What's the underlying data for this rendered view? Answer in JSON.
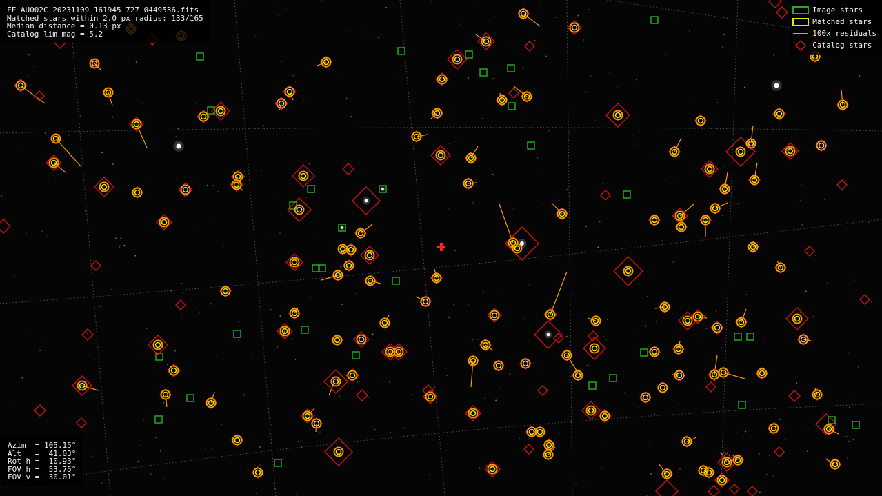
{
  "overlay": {
    "filename": "FF_AU002C_20231109_161945_727_0449536.fits",
    "matched": "Matched stars within 2.0 px radius: 133/165",
    "median": "Median distance = 0.13 px",
    "limmag": "Catalog lim mag = 5.2"
  },
  "pointing": {
    "azim": "Azim  = 105.15°",
    "alt": "Alt   =  41.03°",
    "roth": "Rot h =  10.93°",
    "fovh": "FOV h =  53.75°",
    "fovv": "FOV v =  30.01°"
  },
  "legend": {
    "image_stars": "Image stars",
    "matched_stars": "Matched stars",
    "residuals": "100x residuals",
    "catalog_stars": "Catalog stars"
  },
  "colors": {
    "image": "#22aa22",
    "matched": "#e6e600",
    "residual": "#ff9900",
    "catalog": "#cc1111",
    "center": "#ff2222",
    "grid": "#8a8a8a"
  },
  "icons": {
    "center_marker": "red-cross-icon"
  }
}
